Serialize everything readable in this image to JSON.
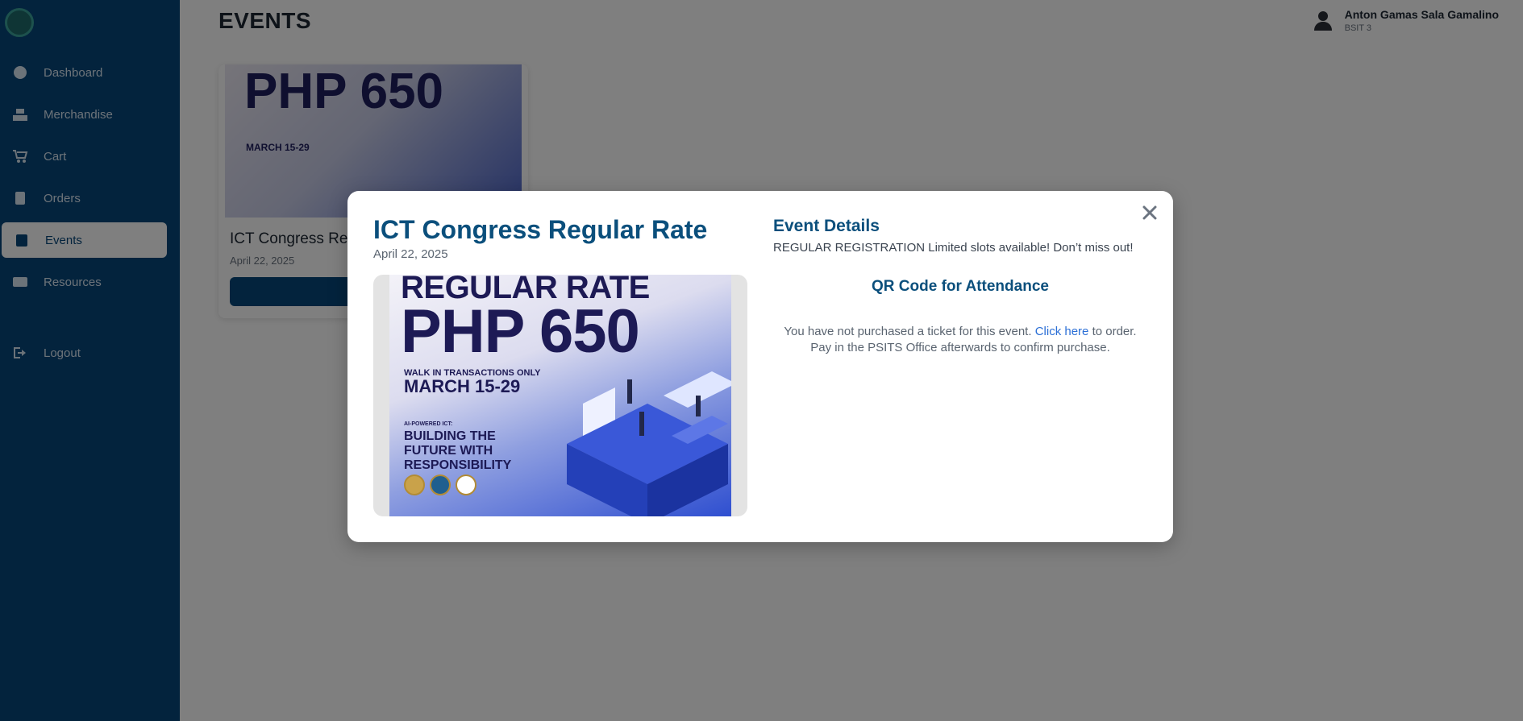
{
  "sidebar": {
    "items": [
      {
        "label": "Dashboard",
        "icon": "dashboard-icon"
      },
      {
        "label": "Merchandise",
        "icon": "merchandise-icon"
      },
      {
        "label": "Cart",
        "icon": "cart-icon"
      },
      {
        "label": "Orders",
        "icon": "orders-icon"
      },
      {
        "label": "Events",
        "icon": "events-icon",
        "active": true
      },
      {
        "label": "Resources",
        "icon": "resources-icon"
      }
    ],
    "logout_label": "Logout"
  },
  "header": {
    "title": "EVENTS",
    "user_name": "Anton Gamas Sala Gamalino",
    "user_role": "BSIT 3"
  },
  "event_card": {
    "poster_headline": "PHP 650",
    "poster_subline": "MARCH 15-29",
    "title": "ICT Congress Re",
    "date": "April 22, 2025"
  },
  "modal": {
    "title": "ICT Congress Regular Rate",
    "date": "April 22, 2025",
    "details_heading": "Event Details",
    "description": "REGULAR REGISTRATION Limited slots available! Don’t miss out!",
    "qr_heading": "QR Code for Attendance",
    "notice_before_link": "You have not purchased a ticket for this event.",
    "notice_link": "Click here",
    "notice_after_link": "to order.",
    "notice_line2": "Pay in the PSITS Office afterwards to confirm purchase.",
    "poster": {
      "line1": "REGULAR RATE",
      "line2": "PHP 650",
      "line3": "WALK IN TRANSACTIONS ONLY",
      "line4": "MARCH 15-29",
      "line5": "AI-POWERED ICT:",
      "line6": "BUILDING THE FUTURE WITH RESPONSIBILITY"
    }
  },
  "colors": {
    "sidebar_bg": "#07467a",
    "accent": "#0b4f7c",
    "link": "#2b6fd6",
    "overlay": "rgba(0,0,0,0.5)"
  }
}
